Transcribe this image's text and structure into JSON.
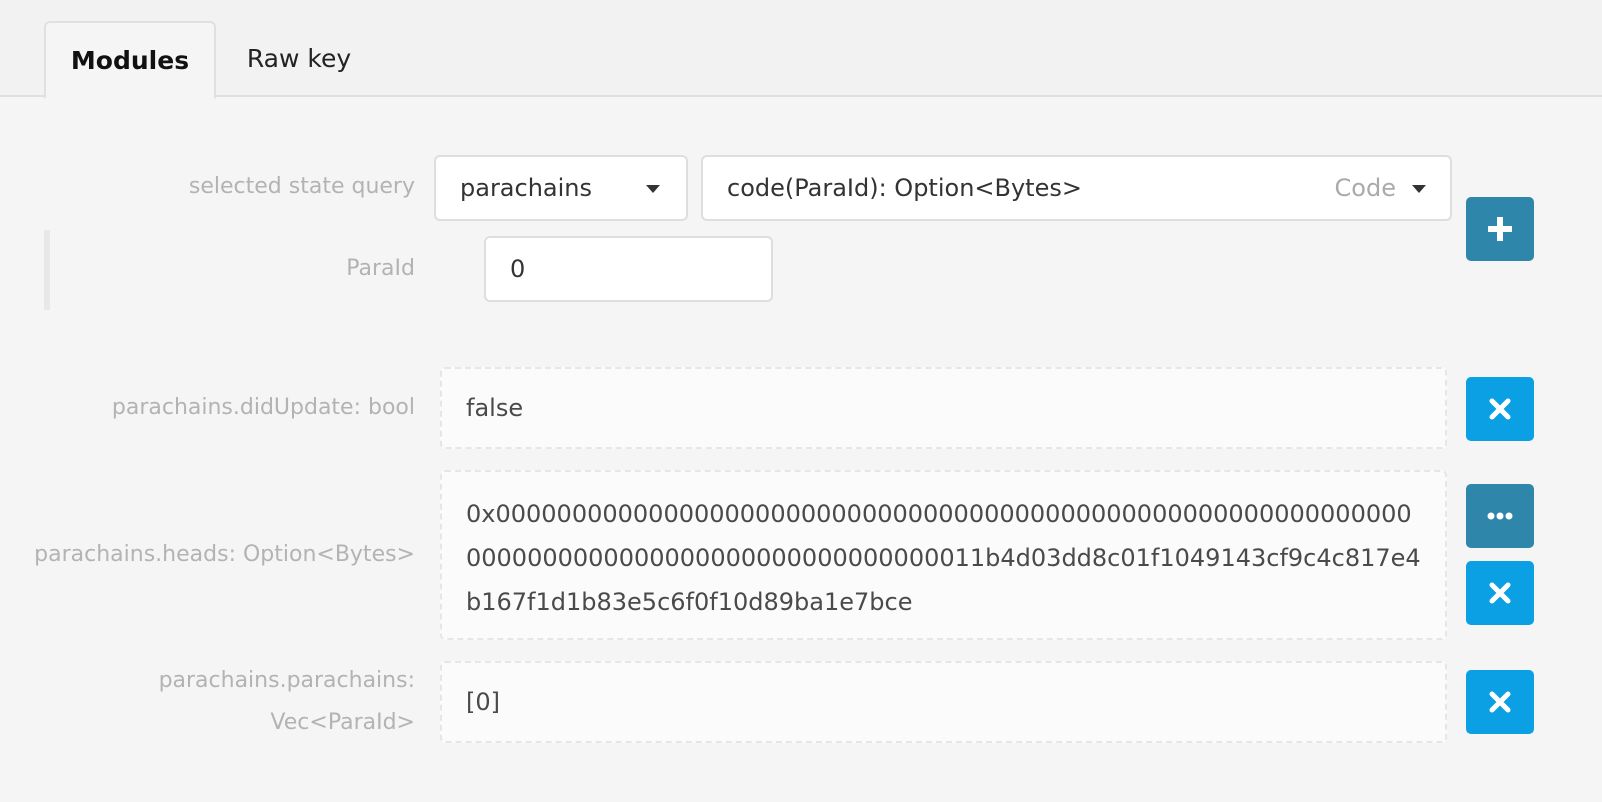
{
  "tabs": [
    {
      "label": "Modules",
      "active": true
    },
    {
      "label": "Raw key",
      "active": false
    }
  ],
  "query": {
    "label": "selected state query",
    "module": "parachains",
    "method": "code(ParaId): Option<Bytes>",
    "method_hint": "Code",
    "param_label": "ParaId",
    "param_value": "0"
  },
  "results": [
    {
      "label": "parachains.didUpdate: bool",
      "value": "false"
    },
    {
      "label": "parachains.heads: Option<Bytes>",
      "value": "0x0000000000000000000000000000000000000000000000000000000000000000000000000000000000000000000011b4d03dd8c01f1049143cf9c4c817e4b167f1d1b83e5c6f0f10d89ba1e7bce"
    },
    {
      "label_line1": "parachains.parachains:",
      "label_line2": "Vec<ParaId>",
      "value": "[0]"
    }
  ],
  "icons": {
    "add": "plus-icon",
    "remove": "close-icon",
    "more": "ellipsis-icon"
  },
  "colors": {
    "primary_button": "#2e86ab",
    "remove_button": "#0ba0e3"
  }
}
